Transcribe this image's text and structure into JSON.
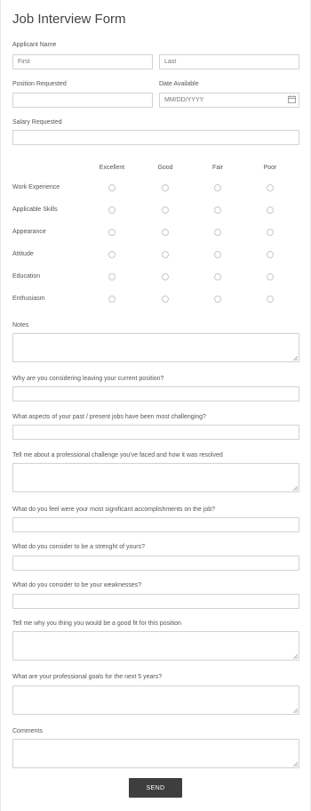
{
  "form": {
    "title": "Job Interview Form",
    "applicant_name": {
      "label": "Applicant Name",
      "first_placeholder": "First",
      "last_placeholder": "Last"
    },
    "position_requested": {
      "label": "Position Requested"
    },
    "date_available": {
      "label": "Date Available",
      "placeholder": "MM/DD/YYYY"
    },
    "salary_requested": {
      "label": "Salary Requested"
    },
    "rating": {
      "columns": [
        "Excellent",
        "Good",
        "Fair",
        "Poor"
      ],
      "rows": [
        "Work Experience",
        "Applicable Skills",
        "Appearance",
        "Attitude",
        "Education",
        "Enthusiasm"
      ]
    },
    "notes": {
      "label": "Notes"
    },
    "q_leaving": {
      "label": "Why are you considering leaving your current position?"
    },
    "q_challenging": {
      "label": "What aspects of your past / present jobs have been most challenging?"
    },
    "q_challenge_resolved": {
      "label": "Tell me about a professional challenge you've faced and how it was resolved"
    },
    "q_accomplishments": {
      "label": "What do you feel were your most significant accomplishments on the job?"
    },
    "q_strength": {
      "label": "What do you consider to be a strenght of yours?"
    },
    "q_weaknesses": {
      "label": "What do you consider to be your weaknesses?"
    },
    "q_good_fit": {
      "label": "Tell me why you thing you would be a good fit for this position"
    },
    "q_goals": {
      "label": "What are your professional goals for the next 5 years?"
    },
    "comments": {
      "label": "Comments"
    },
    "send_label": "SEND"
  },
  "icons": {
    "date": "calendar-icon",
    "resize": "resize-grip-icon"
  }
}
